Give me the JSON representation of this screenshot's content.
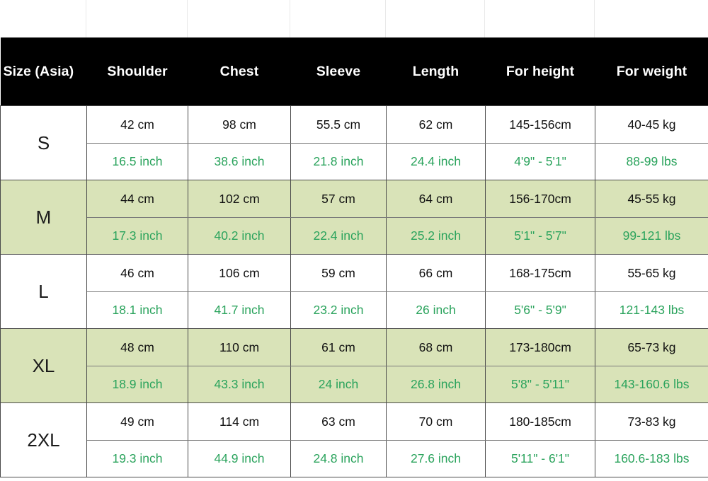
{
  "table": {
    "headers": [
      "Size (Asia)",
      "Shoulder",
      "Chest",
      "Sleeve",
      "Length",
      "For height",
      "For weight"
    ],
    "colors": {
      "header_background": "#000000",
      "header_text": "#ffffff",
      "shaded_row_background": "#d9e3b8",
      "plain_row_background": "#ffffff",
      "metric_text": "#111111",
      "imperial_text": "#2aa35c",
      "border": "#4a4a4a"
    },
    "rows": [
      {
        "size": "S",
        "shaded": false,
        "metric": [
          "42 cm",
          "98 cm",
          "55.5 cm",
          "62 cm",
          "145-156cm",
          "40-45 kg"
        ],
        "imperial": [
          "16.5 inch",
          "38.6 inch",
          "21.8 inch",
          "24.4 inch",
          "4'9\" - 5'1\"",
          "88-99 lbs"
        ]
      },
      {
        "size": "M",
        "shaded": true,
        "metric": [
          "44 cm",
          "102 cm",
          "57 cm",
          "64 cm",
          "156-170cm",
          "45-55 kg"
        ],
        "imperial": [
          "17.3 inch",
          "40.2 inch",
          "22.4 inch",
          "25.2 inch",
          "5'1\" - 5'7\"",
          "99-121 lbs"
        ]
      },
      {
        "size": "L",
        "shaded": false,
        "metric": [
          "46 cm",
          "106 cm",
          "59 cm",
          "66 cm",
          "168-175cm",
          "55-65 kg"
        ],
        "imperial": [
          "18.1 inch",
          "41.7 inch",
          "23.2 inch",
          "26 inch",
          "5'6\" - 5'9\"",
          "121-143 lbs"
        ]
      },
      {
        "size": "XL",
        "shaded": true,
        "metric": [
          "48 cm",
          "110 cm",
          "61 cm",
          "68 cm",
          "173-180cm",
          "65-73 kg"
        ],
        "imperial": [
          "18.9 inch",
          "43.3 inch",
          "24 inch",
          "26.8 inch",
          "5'8\" - 5'11\"",
          "143-160.6 lbs"
        ]
      },
      {
        "size": "2XL",
        "shaded": false,
        "metric": [
          "49 cm",
          "114 cm",
          "63 cm",
          "70 cm",
          "180-185cm",
          "73-83 kg"
        ],
        "imperial": [
          "19.3 inch",
          "44.9 inch",
          "24.8 inch",
          "27.6 inch",
          "5'11\" - 6'1\"",
          "160.6-183 lbs"
        ]
      }
    ]
  }
}
